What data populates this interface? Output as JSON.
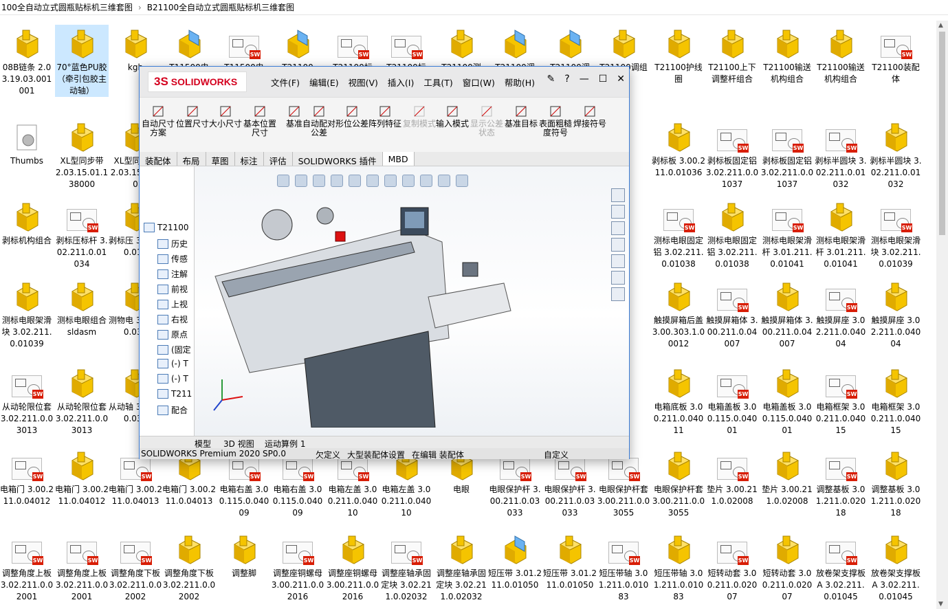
{
  "breadcrumb": {
    "part1": "100全自动立式圆瓶贴标机三维套图",
    "part2": "B21100全自动立式圆瓶贴标机三维套图",
    "sep": "›"
  },
  "files": [
    {
      "label": "08B链条 2.03.19.03.001001",
      "icon": "part"
    },
    {
      "label": "70°蓝色PU胶（牵引包胶主动轴）",
      "icon": "part"
    },
    {
      "label": "kgb",
      "icon": "part"
    },
    {
      "label": "T11500电",
      "icon": "asm"
    },
    {
      "label": "T11500电",
      "icon": "drw"
    },
    {
      "label": "T21100",
      "icon": "asm"
    },
    {
      "label": "T21100标",
      "icon": "drw"
    },
    {
      "label": "T21100标",
      "icon": "drw"
    },
    {
      "label": "T21100测",
      "icon": "part"
    },
    {
      "label": "T21100调",
      "icon": "asm"
    },
    {
      "label": "T21100调",
      "icon": "asm"
    },
    {
      "label": "T21100调组合",
      "icon": "part"
    },
    {
      "label": "T21100护线圈",
      "icon": "part"
    },
    {
      "label": "T21100上下调整杆组合",
      "icon": "part"
    },
    {
      "label": "T21100输送机构组合",
      "icon": "part"
    },
    {
      "label": "T21100输送机构组合",
      "icon": "part"
    },
    {
      "label": "T21100装配体",
      "icon": "drw"
    },
    {
      "label": "Thumbs",
      "icon": "gear"
    },
    {
      "label": "XL型同步带 2.03.15.01.138000",
      "icon": "part"
    },
    {
      "label": "XL型同步带 2.03.15.2220",
      "icon": "part"
    },
    {
      "label": "剥标板 3.00.211.0.01036",
      "icon": "part"
    },
    {
      "label": "剥标板固定铝 3.02.211.0.01037",
      "icon": "drw"
    },
    {
      "label": "剥标板固定铝 3.02.211.0.01037",
      "icon": "drw"
    },
    {
      "label": "剥标半圆块 3.02.211.0.01032",
      "icon": "drw"
    },
    {
      "label": "剥标半圆块 3.02.211.0.01032",
      "icon": "part"
    },
    {
      "label": "剥标机构组合",
      "icon": "part"
    },
    {
      "label": "剥标压标杆 3.02.211.0.01034",
      "icon": "drw"
    },
    {
      "label": "剥标压 3.02.2 0.010",
      "icon": "part"
    },
    {
      "label": "测标电眼固定铝 3.02.211.0.01038",
      "icon": "drw"
    },
    {
      "label": "测标电眼固定铝 3.02.211.0.01038",
      "icon": "part"
    },
    {
      "label": "测标电眼架滑杆 3.01.211.0.01041",
      "icon": "drw"
    },
    {
      "label": "测标电眼架滑杆 3.01.211.0.01041",
      "icon": "part"
    },
    {
      "label": "测标电眼架滑块 3.02.211.0.01039",
      "icon": "drw"
    },
    {
      "label": "测标电眼架滑块 3.02.211.0.01039",
      "icon": "part"
    },
    {
      "label": "测标电眼组合sldasm",
      "icon": "part"
    },
    {
      "label": "测物电 3.02.2 0.030",
      "icon": "part"
    },
    {
      "label": "触摸屏箱后盖 3.00.303.1.00012",
      "icon": "part"
    },
    {
      "label": "触摸屏箱体 3.00.211.0.04007",
      "icon": "drw"
    },
    {
      "label": "触摸屏箱体 3.00.211.0.04007",
      "icon": "part"
    },
    {
      "label": "触摸屏座 3.02.211.0.04004",
      "icon": "drw"
    },
    {
      "label": "触摸屏座 3.02.211.0.04004",
      "icon": "part"
    },
    {
      "label": "从动轮限位套 3.02.211.0.03013",
      "icon": "drw"
    },
    {
      "label": "从动轮限位套 3.02.211.0.03013",
      "icon": "part"
    },
    {
      "label": "从动轴 3.01.2 0.030",
      "icon": "part"
    },
    {
      "label": "电箱底板 3.00.211.0.04011",
      "icon": "part"
    },
    {
      "label": "电箱盖板 3.00.115.0.04001",
      "icon": "drw"
    },
    {
      "label": "电箱盖板 3.00.115.0.04001",
      "icon": "part"
    },
    {
      "label": "电箱框架 3.00.211.0.04015",
      "icon": "drw"
    },
    {
      "label": "电箱框架 3.00.211.0.04015",
      "icon": "part"
    },
    {
      "label": "电箱门 3.00.211.0.04012",
      "icon": "drw"
    },
    {
      "label": "电箱门 3.00.211.0.04012",
      "icon": "part"
    },
    {
      "label": "电箱门 3.00.211.0.04013",
      "icon": "drw"
    },
    {
      "label": "电箱门 3.00.211.0.04013",
      "icon": "part"
    },
    {
      "label": "电箱右盖 3.00.115.0.04009",
      "icon": "drw"
    },
    {
      "label": "电箱右盖 3.00.115.0.04009",
      "icon": "drw"
    },
    {
      "label": "电箱左盖 3.00.211.0.04010",
      "icon": "drw"
    },
    {
      "label": "电箱左盖 3.00.211.0.04010",
      "icon": "part"
    },
    {
      "label": "电眼",
      "icon": "part"
    },
    {
      "label": "电眼保护杆 3.00.211.0.03033",
      "icon": "drw"
    },
    {
      "label": "电眼保护杆 3.00.211.0.03033",
      "icon": "drw"
    },
    {
      "label": "电眼保护杆套 3.00.211.0.03055",
      "icon": "drw"
    },
    {
      "label": "电眼保护杆套 3.00.211.0.03055",
      "icon": "part"
    },
    {
      "label": "垫片 3.00.211.0.02008",
      "icon": "drw"
    },
    {
      "label": "垫片 3.00.211.0.02008",
      "icon": "part"
    },
    {
      "label": "调整基板 3.01.211.0.02018",
      "icon": "drw"
    },
    {
      "label": "调整基板 3.01.211.0.02018",
      "icon": "part"
    },
    {
      "label": "调整角度上板 3.02.211.0.02001",
      "icon": "drw"
    },
    {
      "label": "调整角度上板 3.02.211.0.02001",
      "icon": "drw"
    },
    {
      "label": "调整角度下板 3.02.211.0.02002",
      "icon": "drw"
    },
    {
      "label": "调整角度下板 3.02.211.0.02002",
      "icon": "part"
    },
    {
      "label": "调整脚",
      "icon": "part"
    },
    {
      "label": "调整座铜螺母 3.00.211.0.02016",
      "icon": "drw"
    },
    {
      "label": "调整座铜螺母 3.00.211.0.02016",
      "icon": "part"
    },
    {
      "label": "调整座轴承固定块 3.02.211.0.02032",
      "icon": "drw"
    },
    {
      "label": "调整座轴承固定块 3.02.211.0.02032",
      "icon": "part"
    },
    {
      "label": "短压带 3.01.211.0.01050",
      "icon": "asm"
    },
    {
      "label": "短压带 3.01.211.0.01050",
      "icon": "part"
    },
    {
      "label": "短压带轴 3.01.211.0.01083",
      "icon": "drw"
    },
    {
      "label": "短压带轴 3.01.211.0.01083",
      "icon": "part"
    },
    {
      "label": "短转动套 3.00.211.0.02007",
      "icon": "drw"
    },
    {
      "label": "短转动套 3.00.211.0.02007",
      "icon": "part"
    },
    {
      "label": "放卷架支撑板A 3.02.211.0.01045",
      "icon": "drw"
    },
    {
      "label": "放卷架支撑板A 3.02.211.0.01045",
      "icon": "part"
    }
  ],
  "sw": {
    "brand": "SOLIDWORKS",
    "menu": [
      "文件(F)",
      "编辑(E)",
      "视图(V)",
      "插入(I)",
      "工具(T)",
      "窗口(W)",
      "帮助(H)"
    ],
    "ribbon": [
      "自动尺寸方案",
      "位置尺寸",
      "大小尺寸",
      "基本位置尺寸",
      "基准",
      "自动配对公差",
      "形位公差",
      "阵列特征",
      "复制模式",
      "输入模式",
      "显示公差状态",
      "基准目标",
      "表面粗糙度符号",
      "焊接符号"
    ],
    "tabs": [
      "装配体",
      "布局",
      "草图",
      "标注",
      "评估",
      "SOLIDWORKS 插件",
      "MBD"
    ],
    "tree": [
      "T21100",
      "历史",
      "传感",
      "注解",
      "前视",
      "上视",
      "右视",
      "原点",
      "(固定",
      "(-) T",
      "(-) T",
      "T211",
      "配合"
    ],
    "bottom_tabs": [
      "模型",
      "3D 视图",
      "运动算例 1"
    ],
    "status": {
      "version": "SOLIDWORKS Premium 2020 SP0.0",
      "s1": "欠定义",
      "s2": "大型装配体设置",
      "s3": "在编辑 装配体",
      "s4": "自定义"
    },
    "accent": "#d4001e"
  }
}
